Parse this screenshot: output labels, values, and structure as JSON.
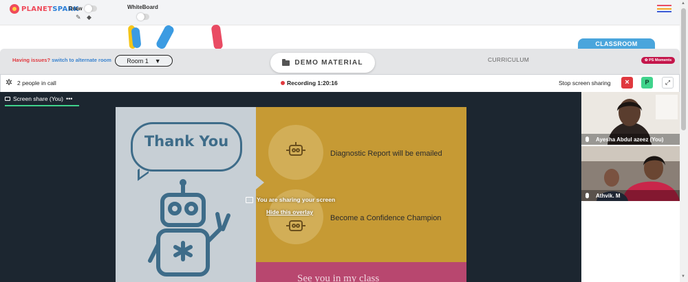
{
  "brand": {
    "logo_part1": "PLANET",
    "logo_part2": "SPARK"
  },
  "toolbar": {
    "draw_label": "Draw",
    "whiteboard_label": "WhiteBoard",
    "menu_colors": [
      "#e94b63",
      "#f5a623",
      "#3b5bd9"
    ]
  },
  "classroom_tab": "CLASSROOM",
  "session_bar": {
    "issues_text": "Having issues?",
    "alternate_room_link": "switch to alternate room",
    "room_selected": "Room 1",
    "demo_material": "DEMO MATERIAL",
    "curriculum": "CURRICULUM",
    "ps_moments": "PS Moments"
  },
  "call_header": {
    "people_count": "2 people in call",
    "recording_label": "Recording",
    "recording_time": "1:20:16",
    "stop_sharing": "Stop screen sharing",
    "close_label": "×",
    "p_label": "P",
    "expand_label": "⤢"
  },
  "stage": {
    "share_tab_label": "Screen share (You)",
    "share_tab_menu": "•••",
    "overlay_message": "You are sharing your screen",
    "hide_overlay": "Hide this overlay"
  },
  "slide": {
    "thank_you": "Thank You",
    "diagnostic": "Diagnostic Report will be emailed",
    "confidence": "Become a Confidence Champion",
    "farewell": "See you in my class"
  },
  "participants": [
    {
      "name": "Ayesha Abdul azeez (You)"
    },
    {
      "name": "Athvik. M"
    }
  ],
  "colors": {
    "accent_green": "#40d38c",
    "record_red": "#e0383e",
    "classroom_blue": "#4aa5dc",
    "slide_yellow": "#c69a34",
    "slide_grey": "#c7cfd5",
    "slide_pink": "#b8476f"
  }
}
